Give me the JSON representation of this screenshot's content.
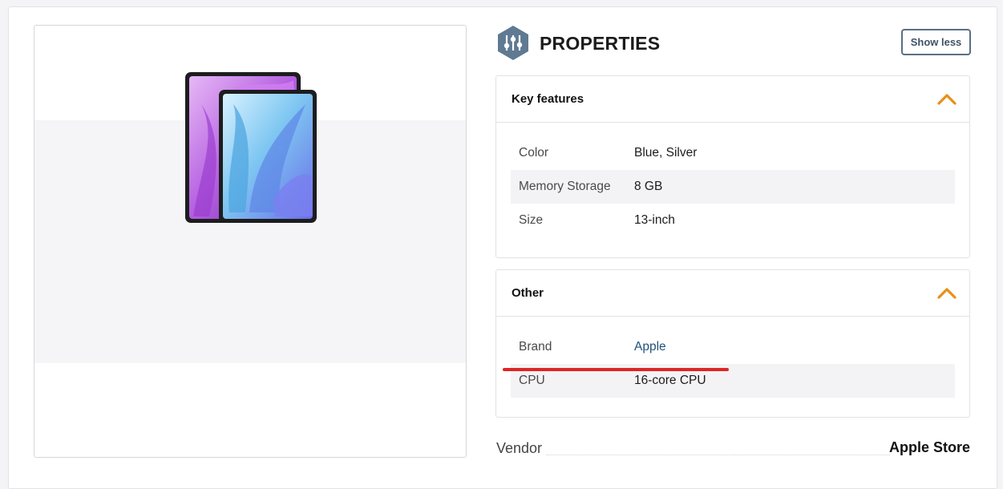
{
  "product_image": {
    "icon": "ipad-product-image"
  },
  "properties": {
    "title": "PROPERTIES",
    "icon": "sliders-icon",
    "show_less_label": "Show less"
  },
  "sections": {
    "key_features": {
      "title": "Key features",
      "expanded": true,
      "rows": [
        {
          "label": "Color",
          "value": "Blue, Silver"
        },
        {
          "label": "Memory Storage",
          "value": "8 GB"
        },
        {
          "label": "Size",
          "value": "13-inch"
        }
      ]
    },
    "other": {
      "title": "Other",
      "expanded": true,
      "rows": [
        {
          "label": "Brand",
          "value": "Apple"
        },
        {
          "label": "CPU",
          "value": "16-core CPU"
        }
      ]
    }
  },
  "vendor": {
    "label": "Vendor",
    "value": "Apple Store"
  },
  "colors": {
    "accent": "#e8901a",
    "icon_badge": "#5f7a92",
    "link": "#20527a",
    "highlight_line": "#e02424"
  }
}
